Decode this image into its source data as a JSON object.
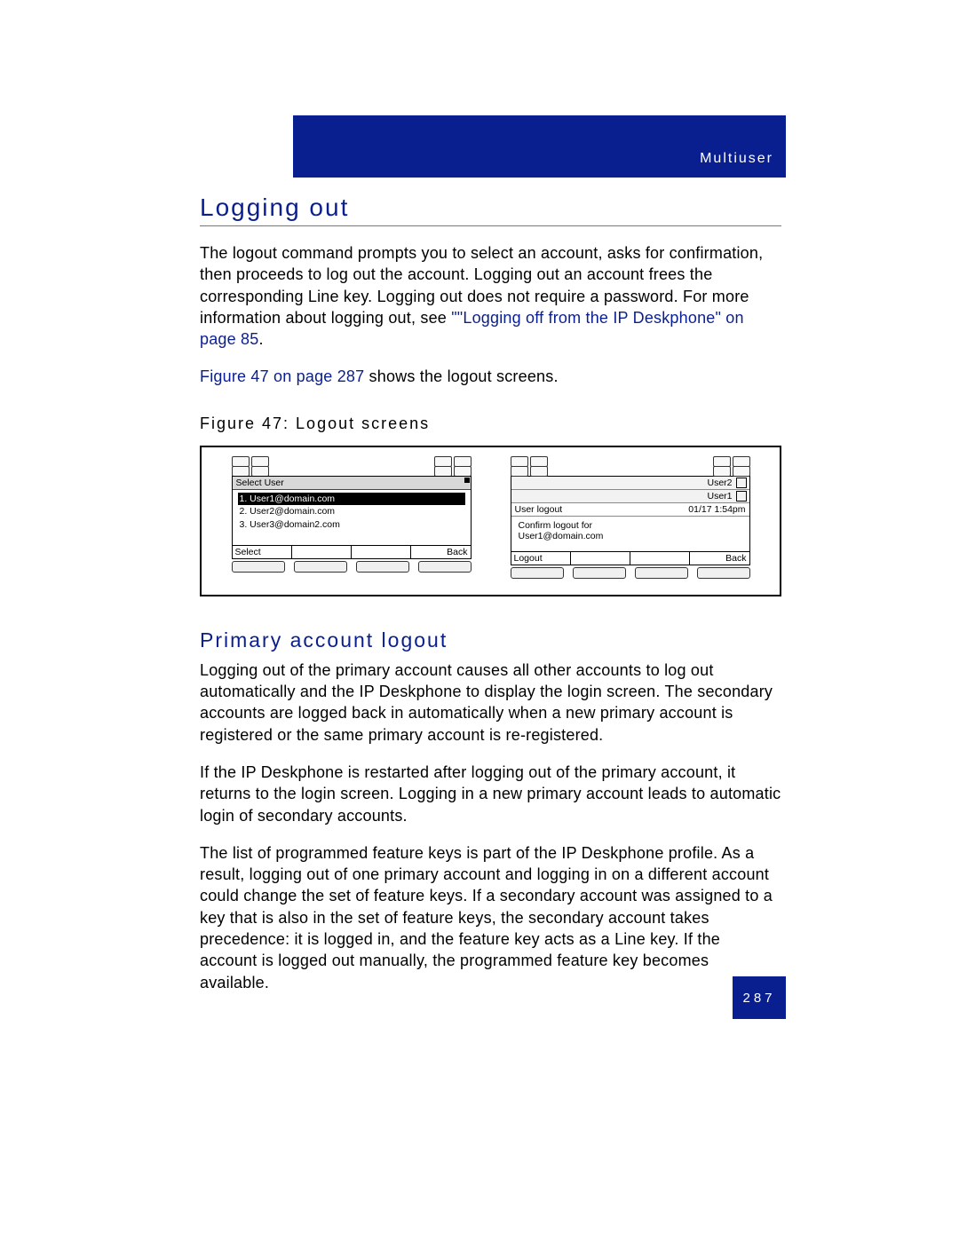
{
  "header": {
    "section": "Multiuser"
  },
  "title": "Logging out",
  "para1_plain": "The logout command prompts you to select an account, asks for confirmation, then proceeds to log out the account. Logging out an account frees the corresponding Line key. Logging out does not require a password. For more information about logging out, see ",
  "link1": "\"\"Logging off from the IP Deskphone\" on page 85",
  "para1_tail": ".",
  "link2": "Figure 47 on page 287",
  "para2_tail": " shows the logout screens.",
  "figure_caption": "Figure 47: Logout screens",
  "screenA": {
    "title": "Select User",
    "items": [
      "1. User1@domain.com",
      "2. User2@domain.com",
      "3. User3@domain2.com"
    ],
    "softkeys": {
      "left": "Select",
      "right": "Back"
    }
  },
  "screenB": {
    "tabs": {
      "user2": "User2",
      "user1": "User1"
    },
    "status": {
      "left": "User logout",
      "right": "01/17 1:54pm"
    },
    "confirm_l1": "Confirm logout for",
    "confirm_l2": "User1@domain.com",
    "softkeys": {
      "left": "Logout",
      "right": "Back"
    }
  },
  "subheading": "Primary account logout",
  "para3": "Logging out of the primary account causes all other accounts to log out automatically and the IP Deskphone to display the login screen. The secondary accounts are logged back in automatically when a new primary account is registered or the same primary account is re-registered.",
  "para4": "If the IP Deskphone is restarted after logging out of the primary account, it returns to the login screen. Logging in a new primary account leads to automatic login of secondary accounts.",
  "para5": "The list of programmed feature keys is part of the IP Deskphone profile. As a result, logging out of one primary account and logging in on a different account could change the set of feature keys. If a secondary account was assigned to a key that is also in the set of feature keys, the secondary account takes precedence: it is logged in, and the feature key acts as a Line key. If the account is logged out manually, the programmed feature key becomes available.",
  "page_number": "287"
}
